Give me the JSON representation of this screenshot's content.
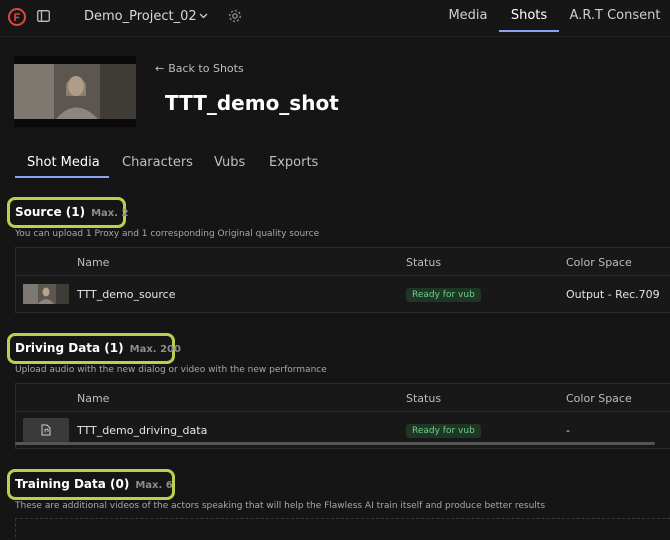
{
  "app": {
    "project_name": "Demo_Project_02"
  },
  "nav": {
    "tabs": [
      {
        "label": "Media"
      },
      {
        "label": "Shots"
      },
      {
        "label": "A.R.T Consent"
      }
    ],
    "active": "Shots"
  },
  "header": {
    "back_label": "Back to Shots",
    "shot_title": "TTT_demo_shot"
  },
  "page_tabs": {
    "items": [
      {
        "label": "Shot Media"
      },
      {
        "label": "Characters"
      },
      {
        "label": "Vubs"
      },
      {
        "label": "Exports"
      }
    ],
    "active": "Shot Media"
  },
  "sections": {
    "source": {
      "title": "Source (1)",
      "max": "Max. 2",
      "description": "You can upload 1 Proxy and 1 corresponding Original quality source",
      "columns": [
        "Name",
        "Status",
        "Color Space"
      ],
      "rows": [
        {
          "name": "TTT_demo_source",
          "status": "Ready for vub",
          "color_space": "Output - Rec.709"
        }
      ]
    },
    "driving": {
      "title": "Driving Data (1)",
      "max": "Max. 200",
      "description": "Upload audio with the new dialog or video with the new performance",
      "columns": [
        "Name",
        "Status",
        "Color Space"
      ],
      "rows": [
        {
          "name": "TTT_demo_driving_data",
          "status": "Ready for vub",
          "color_space": "-"
        }
      ]
    },
    "training": {
      "title": "Training Data (0)",
      "max": "Max. 6",
      "description": "These are additional videos of the actors speaking that will help the Flawless AI train itself and produce better results"
    }
  },
  "colors": {
    "accent": "#8aa3f2",
    "highlight": "#b9d24b",
    "status_ready": "#6fd08c",
    "logo": "#e0463e"
  },
  "icons": {
    "logo": "flawless-logo-icon",
    "sidebar": "sidebar-toggle-icon",
    "chevron": "chevron-down-icon",
    "settings": "gear-icon",
    "back": "arrow-left-icon",
    "audio_file": "audio-file-icon"
  }
}
